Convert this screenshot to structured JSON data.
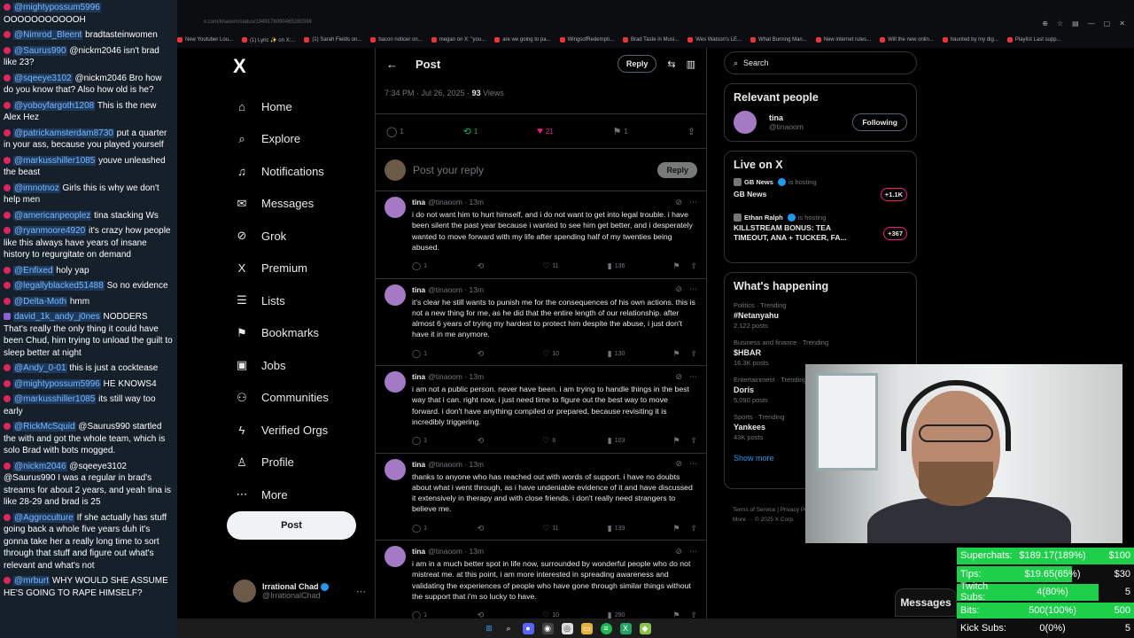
{
  "chat": [
    {
      "user": "@mightypossum5996",
      "text": "OOOOOOOOOOOH",
      "badge": "red"
    },
    {
      "user": "@Nimrod_Bleent",
      "text": "bradtasteinwomen",
      "badge": "red"
    },
    {
      "user": "@Saurus990",
      "text": "@nickm2046 isn't brad like 23?",
      "badge": "red"
    },
    {
      "user": "@sqeeye3102",
      "text": "@nickm2046 Bro how do you know that? Also how old is he?",
      "badge": "red"
    },
    {
      "user": "@yoboyfargoth1208",
      "text": "This is the new Alex Hez",
      "badge": "red"
    },
    {
      "user": "@patrickamsterdam8730",
      "text": "put a quarter in your ass, because you played yourself",
      "badge": "red"
    },
    {
      "user": "@markusshiller1085",
      "text": "youve unleashed the beast",
      "badge": "red"
    },
    {
      "user": "@imnotnoz",
      "text": "Girls this is why we don't help men",
      "badge": "red"
    },
    {
      "user": "@americanpeoplez",
      "text": "tina stacking Ws",
      "badge": "red"
    },
    {
      "user": "@ryanmoore4920",
      "text": "it's crazy how people like this always have years of insane history to regurgitate on demand",
      "badge": "red"
    },
    {
      "user": "@Enfixed",
      "text": "holy yap",
      "badge": "red"
    },
    {
      "user": "@legallyblacked51488",
      "text": "So no evidence",
      "badge": "red"
    },
    {
      "user": "@Delta-Moth",
      "text": "hmm",
      "badge": "red"
    },
    {
      "user": "david_1k_andy_j0nes",
      "text": "NODDERS That's really the only thing it could have been Chud, him trying to unload the guilt to sleep better at night",
      "badge": "purple"
    },
    {
      "user": "@Andy_0-01",
      "text": "this is just a cocktease",
      "badge": "red"
    },
    {
      "user": "@mightypossum5996",
      "text": "HE KNOWS4",
      "badge": "red"
    },
    {
      "user": "@markusshiller1085",
      "text": "its still way too early",
      "badge": "red"
    },
    {
      "user": "@RickMcSquid",
      "text": "@Saurus990 startled the with and got the whole team, which is solo Brad with bots mogged.",
      "badge": "red"
    },
    {
      "user": "@nickm2046",
      "text": "@sqeeye3102 @Saurus990 I was a regular in brad's streams for about 2 years, and yeah tina is like 28-29 and brad is 25",
      "badge": "red"
    },
    {
      "user": "@Aggroculture",
      "text": "If she actually has stuff going back a whole five years duh it's gonna take her a really long time to sort through that stuff and figure out what's relevant and what's not",
      "badge": "red"
    },
    {
      "user": "@mrburt",
      "text": "WHY WOULD SHE ASSUME HE'S GOING TO RAPE HIMSELF?",
      "badge": "red"
    }
  ],
  "browser": {
    "url": "x.com/tinaoom/status/1949178090465280398",
    "bookmarks": [
      "New Youtuber Lou...",
      "(1) Lyric ✨ on X:...",
      "(1) Sarah Fields on...",
      "bacon noticer on...",
      "megan on X: \"you...",
      "are we going to pa...",
      "WingsofRedempti...",
      "Brad Taste in Musi...",
      "Wes Watson's LE...",
      "What Burning Man...",
      "New internet rules...",
      "Will the new onlin...",
      "haunted by my dig...",
      "Playlist Last supp..."
    ]
  },
  "nav": {
    "logo": "X",
    "items": [
      {
        "key": "home",
        "label": "Home",
        "icon": "⌂"
      },
      {
        "key": "explore",
        "label": "Explore",
        "icon": "⌕"
      },
      {
        "key": "notifications",
        "label": "Notifications",
        "icon": "♫"
      },
      {
        "key": "messages",
        "label": "Messages",
        "icon": "✉"
      },
      {
        "key": "grok",
        "label": "Grok",
        "icon": "⊘"
      },
      {
        "key": "premium",
        "label": "Premium",
        "icon": "X"
      },
      {
        "key": "lists",
        "label": "Lists",
        "icon": "☰"
      },
      {
        "key": "bookmarks",
        "label": "Bookmarks",
        "icon": "⚑"
      },
      {
        "key": "jobs",
        "label": "Jobs",
        "icon": "▣"
      },
      {
        "key": "communities",
        "label": "Communities",
        "icon": "⚇"
      },
      {
        "key": "verified",
        "label": "Verified Orgs",
        "icon": "ϟ"
      },
      {
        "key": "profile",
        "label": "Profile",
        "icon": "♙"
      },
      {
        "key": "more",
        "label": "More",
        "icon": "⋯"
      }
    ],
    "post_label": "Post",
    "account": {
      "name": "Irrational Chad",
      "handle": "@IrrationalChad"
    }
  },
  "main": {
    "title": "Post",
    "reply_label": "Reply",
    "meta_time": "7:34 PM · Jul 26, 2025 · ",
    "meta_views": "93",
    "meta_views_label": " Views",
    "stats": {
      "replies": "1",
      "reposts": "1",
      "likes": "21",
      "bookmarks": "1"
    },
    "compose_placeholder": "Post your reply",
    "compose_button": "Reply",
    "tweets": [
      {
        "name": "tina",
        "handle": "@tinaoom · 13m",
        "text": "i do not want him to hurt himself, and i do not want to get into legal trouble. i have been silent the past year because i wanted to see him get better, and i desperately wanted to move forward with my life after spending half of my twenties being abused.",
        "replies": "1",
        "likes": "11",
        "views": "136"
      },
      {
        "name": "tina",
        "handle": "@tinaoom · 13m",
        "text": "it's clear he still wants to punish me for the consequences of his own actions. this is not a new thing for me, as he did that the entire length of our relationship. after almost 6 years of trying my hardest to protect him despite the abuse, i just don't have it in me anymore.",
        "replies": "1",
        "likes": "10",
        "views": "130"
      },
      {
        "name": "tina",
        "handle": "@tinaoom · 13m",
        "text": "i am not a public person. never have been. i am trying to handle things in the best way that i can. right now, i just need time to figure out the best way to move forward. i don't have anything compiled or prepared, because revisiting it is incredibly triggering.",
        "replies": "1",
        "likes": "8",
        "views": "103"
      },
      {
        "name": "tina",
        "handle": "@tinaoom · 13m",
        "text": "thanks to anyone who has reached out with words of support. i have no doubts about what i went through, as i have undeniable evidence of it and have discussed it extensively in therapy and with close friends. i don't really need strangers to believe me.",
        "replies": "1",
        "likes": "11",
        "views": "139"
      },
      {
        "name": "tina",
        "handle": "@tinaoom · 13m",
        "text": "i am in a much better spot in life now, surrounded by wonderful people who do not mistreat me. at this point, i am more interested in spreading awareness and validating the experiences of people who have gone through similar things without the support that i'm so lucky to have.",
        "replies": "1",
        "likes": "10",
        "views": "290"
      }
    ]
  },
  "right": {
    "search_placeholder": "Search",
    "relevant_title": "Relevant people",
    "person": {
      "name": "tina",
      "handle": "@tinaoom",
      "button": "Following"
    },
    "live_title": "Live on X",
    "live": [
      {
        "host": "GB News",
        "hosting": "is hosting",
        "title": "GB News",
        "count": "+1.1K"
      },
      {
        "host": "Ethan Ralph",
        "hosting": "is hosting",
        "title": "KILLSTREAM BONUS: TEA TIMEOUT, ANA + TUCKER, FA...",
        "count": "+367"
      }
    ],
    "happening_title": "What's happening",
    "trends": [
      {
        "cat": "Politics · Trending",
        "name": "#Netanyahu",
        "count": "2,122 posts"
      },
      {
        "cat": "Business and finance · Trending",
        "name": "$HBAR",
        "count": "16.3K posts"
      },
      {
        "cat": "Entertainment · Trending",
        "name": "Doris",
        "count": "5,090 posts"
      },
      {
        "cat": "Sports · Trending",
        "name": "Yankees",
        "count": "43K posts"
      }
    ],
    "show_more": "Show more",
    "footer1": "Terms of Service | Privacy Policy",
    "footer2": "More ··· © 2025 X Corp."
  },
  "messages_tab": "Messages",
  "donations": [
    {
      "label": "Superchats:",
      "value": "$189.17(189%)",
      "goal": "$100",
      "fill": 1.0
    },
    {
      "label": "Tips:",
      "value": "$19.65(65%)",
      "goal": "$30",
      "fill": 0.65
    },
    {
      "label": "Twitch Subs:",
      "value": "4(80%)",
      "goal": "5",
      "fill": 0.8
    },
    {
      "label": "Bits:",
      "value": "500(100%)",
      "goal": "500",
      "fill": 1.0
    },
    {
      "label": "Kick Subs:",
      "value": "0(0%)",
      "goal": "5",
      "fill": 0.0
    }
  ],
  "colors": {
    "accent": "#1d9bf0",
    "like": "#f91880",
    "repost": "#00ba7c",
    "donation_fill": "#1ecf4a"
  }
}
